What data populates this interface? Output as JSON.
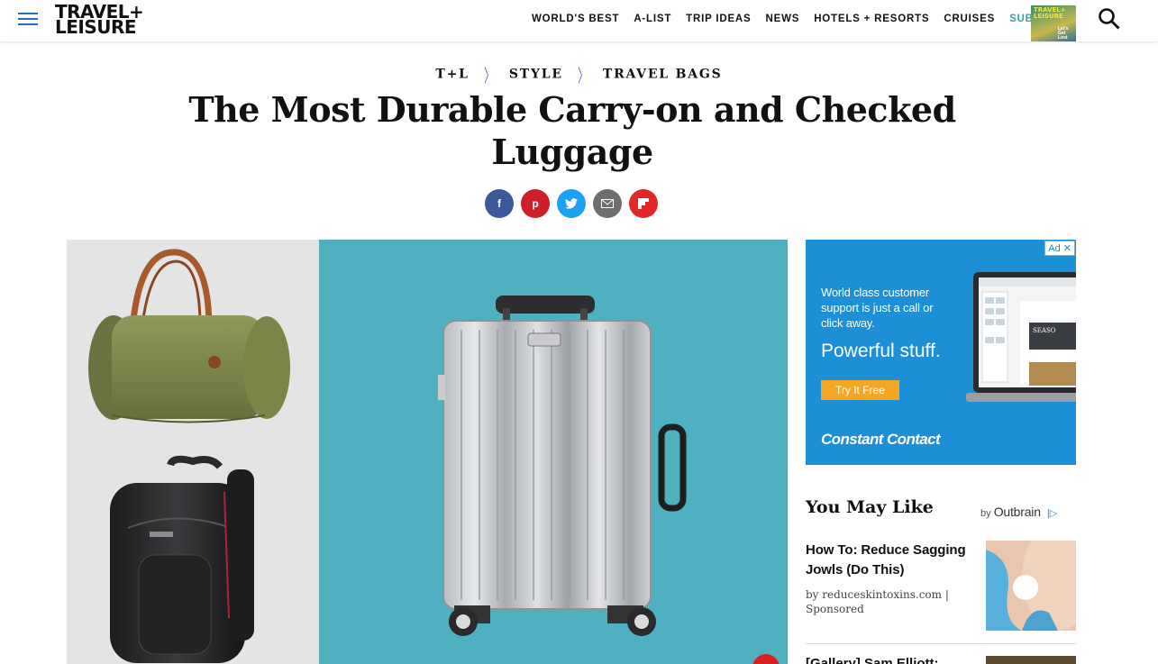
{
  "header": {
    "logo_line1": "TRAVEL+",
    "logo_line2": "LEISURE",
    "nav": [
      "WORLD'S BEST",
      "A-LIST",
      "TRIP IDEAS",
      "NEWS",
      "HOTELS + RESORTS",
      "CRUISES"
    ],
    "subscribe": "SUBSCRIBE",
    "magazine_title_1": "TRAVEL+",
    "magazine_title_2": "LEISURE",
    "magazine_tagline": "Let's Get Lost"
  },
  "breadcrumb": [
    "T+L",
    "STYLE",
    "TRAVEL BAGS"
  ],
  "article": {
    "title": "The Most Durable Carry-on and Checked Luggage"
  },
  "share": {
    "facebook_glyph": "f",
    "pinterest_glyph": "p",
    "twitter_glyph": "t"
  },
  "ad": {
    "badge": "Ad ✕",
    "line1": "World class customer support is just a call or click away.",
    "line2": "Powerful stuff.",
    "button": "Try It Free",
    "brand": "Constant Contact",
    "screen_word": "SEASO"
  },
  "you_may_like": {
    "title": "You May Like",
    "by": "by",
    "provider": "Outbrain",
    "info": "|▷",
    "items": [
      {
        "title": "How To: Reduce Sagging Jowls (Do This)",
        "source": "by reduceskintoxins.com | Sponsored"
      },
      {
        "title": "[Gallery] Sam Elliott:"
      }
    ]
  },
  "colors": {
    "accent": "#3aa39f",
    "crumb_chevron": "#7b5cd6",
    "hero_bg": "#4fb1bf",
    "ad_bg": "#1c8fd6"
  }
}
